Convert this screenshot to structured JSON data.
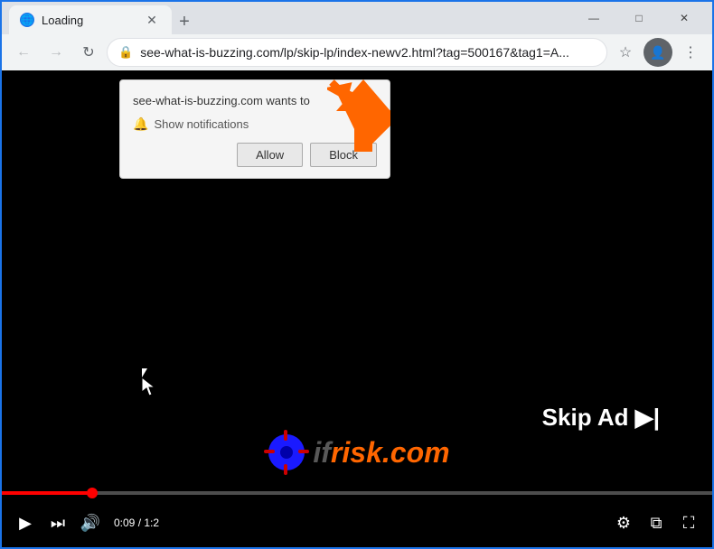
{
  "browser": {
    "tab": {
      "title": "Loading",
      "favicon": "globe"
    },
    "new_tab_label": "+",
    "window_controls": {
      "minimize": "—",
      "maximize": "□",
      "close": "✕"
    },
    "address_bar": {
      "url": "see-what-is-buzzing.com/lp/skip-lp/index-newv2.html?tag=500167&tag1=A...",
      "back": "←",
      "forward": "→",
      "reload": "↻"
    }
  },
  "notification_popup": {
    "title": "see-what-is-buzzing.com wants to",
    "notification_label": "Show notifications",
    "allow_label": "Allow",
    "block_label": "Block",
    "close_label": "×"
  },
  "video": {
    "skip_ad_label": "Skip Ad ▶|",
    "time_current": "0:09",
    "time_total": "1:2",
    "progress_percent": 12
  },
  "watermark": {
    "prefix": "if",
    "suffix": "risk.com"
  },
  "controls": {
    "play": "▶",
    "next": "⏭",
    "volume": "🔊",
    "settings": "⚙",
    "miniplayer": "⧉",
    "fullscreen": "⛶"
  }
}
